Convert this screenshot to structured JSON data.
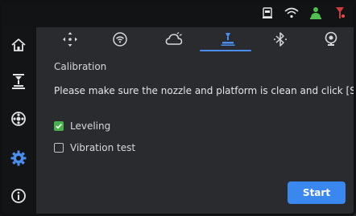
{
  "status_icons": [
    "usb-drive-icon",
    "wifi-icon",
    "user-green-icon",
    "warning-red-icon"
  ],
  "sidebar": {
    "items": [
      {
        "name": "home",
        "icon": "home-icon",
        "active": false
      },
      {
        "name": "printer",
        "icon": "printer-icon",
        "active": false
      },
      {
        "name": "filament",
        "icon": "filament-spool-icon",
        "active": false
      },
      {
        "name": "settings",
        "icon": "gear-icon",
        "active": true
      },
      {
        "name": "info",
        "icon": "info-icon",
        "active": false
      }
    ]
  },
  "tabs": [
    {
      "name": "move",
      "icon": "move-axes-icon",
      "active": false
    },
    {
      "name": "network",
      "icon": "network-icon",
      "active": false
    },
    {
      "name": "cloud",
      "icon": "cloud-icon",
      "active": false
    },
    {
      "name": "calibration",
      "icon": "calibration-icon",
      "active": true
    },
    {
      "name": "bluetooth",
      "icon": "bluetooth-icon",
      "active": false
    },
    {
      "name": "camera",
      "icon": "camera-icon",
      "active": false
    }
  ],
  "calibration": {
    "title": "Calibration",
    "message": "Please make sure the nozzle and platform is clean and click [Start].",
    "options": [
      {
        "label": "Leveling",
        "checked": true
      },
      {
        "label": "Vibration test",
        "checked": false
      }
    ],
    "start_label": "Start"
  },
  "colors": {
    "accent": "#3a87f0",
    "check": "#46b04a",
    "active_icon": "#4a8ff0",
    "inactive_icon": "#d8d9db"
  }
}
